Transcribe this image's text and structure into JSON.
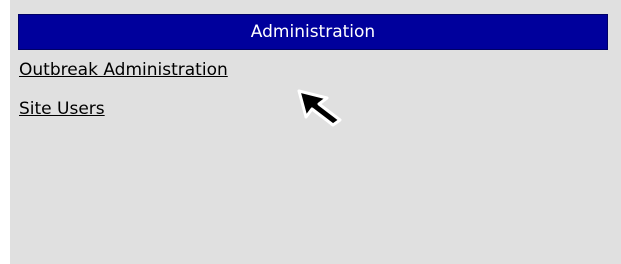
{
  "header": {
    "title": "Administration"
  },
  "links": [
    {
      "label": "Outbreak Administration"
    },
    {
      "label": "Site Users"
    }
  ],
  "colors": {
    "header_background": "#00009c",
    "panel_background": "#e0e0e0"
  },
  "icons": {
    "cursor": "mouse-pointer-icon"
  }
}
